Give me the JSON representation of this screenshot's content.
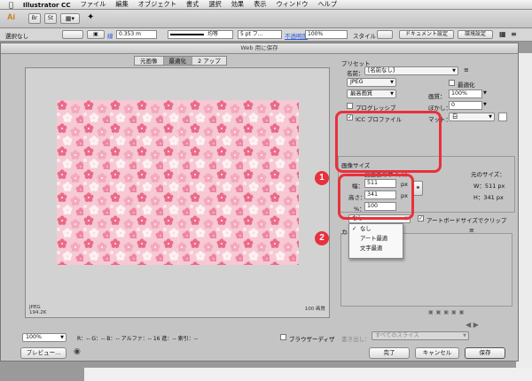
{
  "menubar": {
    "app_name": "Illustrator CC",
    "items": [
      "ファイル",
      "編集",
      "オブジェクト",
      "書式",
      "選択",
      "効果",
      "表示",
      "ウィンドウ",
      "ヘルプ"
    ]
  },
  "appbar": {
    "logo": "Ai"
  },
  "control_bar": {
    "selection": "選択なし",
    "stroke_width": "0.353 m",
    "stroke_label": "線",
    "uniform": "均等",
    "brush": "5 pt フ...",
    "opacity_label": "不透明度",
    "opacity": "100%",
    "style_label": "スタイル",
    "doc_settings": "ドキュメント設定",
    "preferences": "環境設定"
  },
  "dialog": {
    "title": "Web 用に保存",
    "tabs": [
      {
        "label": "元画像"
      },
      {
        "label": "最適化"
      },
      {
        "label": "2 アップ"
      }
    ],
    "preview_info": {
      "format": "JPEG",
      "size": "194.2K",
      "quality": "100 画質"
    },
    "zoom": "100%",
    "readout": "R：-- G：-- B：-- アルファ：-- 16 進：-- 索引：--",
    "browser_dither": "ブラウザーディザ",
    "preview_button": "プレビュー...",
    "preset": {
      "section_label": "プリセット",
      "name_label": "名前：",
      "name_value": "[名前なし]",
      "format": "JPEG",
      "optimize_label": "最適化",
      "quality_preset": "最高画質",
      "quality_label": "画質：",
      "quality_value": "100%",
      "progressive_label": "プログレッシブ",
      "blur_label": "ぼかし：",
      "blur_value": "0",
      "icc_label": "ICC プロファイル",
      "matte_label": "マット：",
      "matte_value": "白"
    },
    "image_size": {
      "section_label": "画像サイズ",
      "new_size_label": "変更後のサイズ：",
      "width_label": "幅：",
      "width_value": "511",
      "height_label": "高さ：",
      "height_value": "341",
      "percent_label": "%：",
      "percent_value": "100",
      "unit": "px",
      "original_label": "元のサイズ：",
      "orig_width": "W：511 px",
      "orig_height": "H：341 px",
      "clip_label": "アートボードサイズでクリップ"
    },
    "antialias": {
      "current": "なし",
      "options": [
        {
          "label": "なし",
          "checked": true
        },
        {
          "label": "アート最適",
          "checked": false
        },
        {
          "label": "文字最適",
          "checked": false
        }
      ],
      "panel_letter": "カ"
    },
    "export_label": "書き出し：",
    "export_value": "すべてのスライス",
    "buttons": {
      "done": "完了",
      "cancel": "キャンセル",
      "save": "保存"
    }
  },
  "callouts": {
    "one": "1",
    "two": "2"
  },
  "colors": {
    "callout": "#e8313c",
    "blossom_light": "#f6c9d4",
    "blossom_dark": "#e96b8a"
  }
}
